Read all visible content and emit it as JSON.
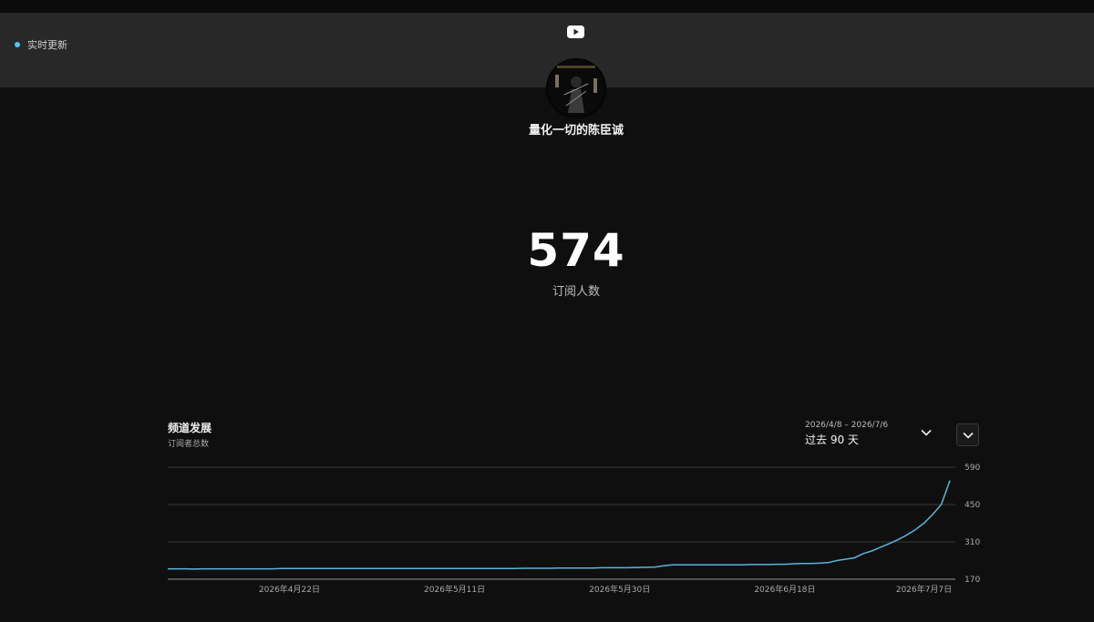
{
  "header": {
    "live_label": "实时更新",
    "channel_name": "量化一切的陈臣诚"
  },
  "stats": {
    "subscriber_count": "574",
    "subscriber_label": "订阅人数"
  },
  "growth": {
    "title": "频道发展",
    "subtitle": "订阅者总数",
    "range_dates": "2026/4/8 – 2026/7/6",
    "range_label": "过去 90 天"
  },
  "colors": {
    "accent": "#4fc3f7",
    "line": "#5ab4dc",
    "background": "#0f0f0f",
    "header": "#282828"
  },
  "icons": {
    "live": "live-dot",
    "logo": "youtube-icon",
    "dropdown": "chevron-down-icon"
  },
  "chart_data": {
    "type": "line",
    "title": "",
    "xlabel": "",
    "ylabel": "",
    "ylim": [
      170,
      590
    ],
    "yticks": [
      590,
      450,
      310,
      170
    ],
    "xticks": [
      {
        "label": "2026年4月22日",
        "day": 14
      },
      {
        "label": "2026年5月11日",
        "day": 33
      },
      {
        "label": "2026年5月30日",
        "day": 52
      },
      {
        "label": "2026年6月18日",
        "day": 71
      },
      {
        "label": "2026年7月7日",
        "day": 87
      }
    ],
    "grid": true,
    "legend": "none",
    "series": [
      {
        "x": [
          0,
          2,
          3,
          4,
          12,
          13,
          40,
          41,
          44,
          45,
          49,
          50,
          53,
          54,
          56,
          57,
          58,
          59,
          66,
          67,
          69,
          70,
          71,
          72,
          73,
          74,
          75,
          76,
          77,
          78,
          79,
          80,
          81,
          82,
          83,
          84,
          85,
          86,
          87,
          88,
          89,
          90
        ],
        "y": [
          209,
          209,
          208,
          209,
          209,
          210,
          210,
          211,
          211,
          212,
          212,
          213,
          213,
          214,
          215,
          220,
          224,
          224,
          224,
          225,
          225,
          226,
          226,
          228,
          229,
          229,
          230,
          232,
          240,
          245,
          250,
          266,
          276,
          290,
          303,
          318,
          335,
          355,
          380,
          412,
          450,
          540
        ]
      }
    ]
  }
}
